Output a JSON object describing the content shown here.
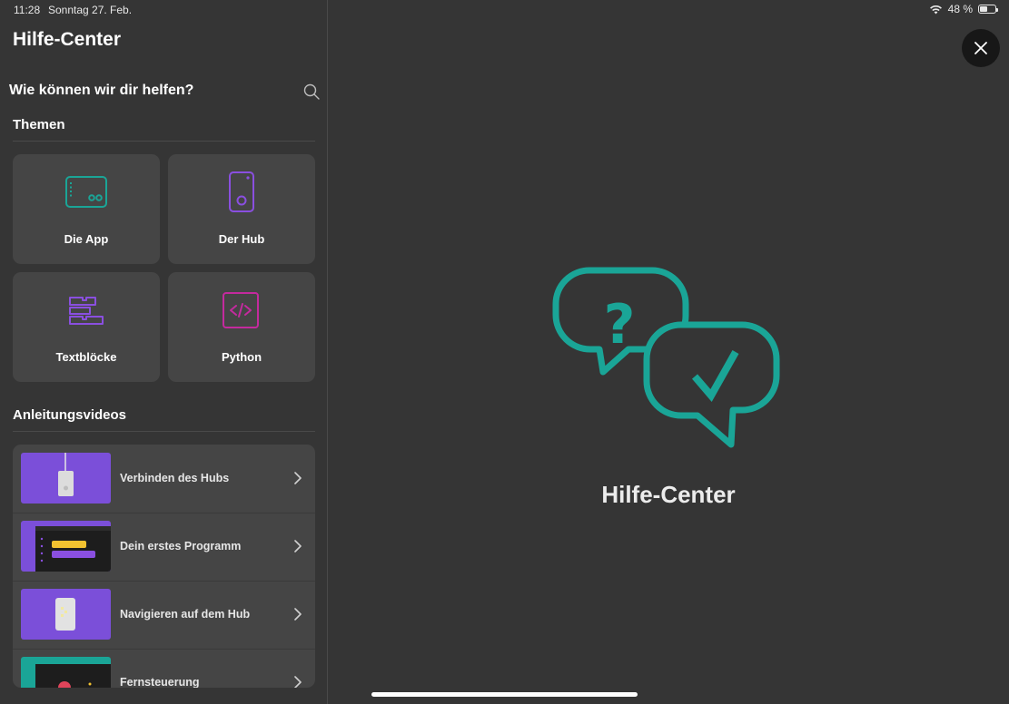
{
  "status": {
    "time": "11:28",
    "date": "Sonntag 27. Feb.",
    "battery": "48 %",
    "battery_level": 0.48
  },
  "sidebar": {
    "title": "Hilfe-Center",
    "search_prompt": "Wie können wir dir helfen?",
    "topics_title": "Themen",
    "topics": [
      {
        "label": "Die App",
        "icon": "tablet-icon",
        "color": "#1aa597"
      },
      {
        "label": "Der Hub",
        "icon": "hub-icon",
        "color": "#8a4fe0"
      },
      {
        "label": "Textblöcke",
        "icon": "text-blocks-icon",
        "color": "#8a4fe0"
      },
      {
        "label": "Python",
        "icon": "python-code-icon",
        "color": "#c42a9e"
      }
    ],
    "videos_title": "Anleitungsvideos",
    "videos": [
      {
        "label": "Verbinden des Hubs"
      },
      {
        "label": "Dein erstes Programm"
      },
      {
        "label": "Navigieren auf dem Hub"
      },
      {
        "label": "Fernsteuerung"
      }
    ]
  },
  "main": {
    "title": "Hilfe-Center",
    "accent": "#1aa597"
  },
  "colors": {
    "background": "#353535",
    "panel": "#454545",
    "accent_teal": "#1aa597",
    "accent_purple": "#8a4fe0"
  }
}
